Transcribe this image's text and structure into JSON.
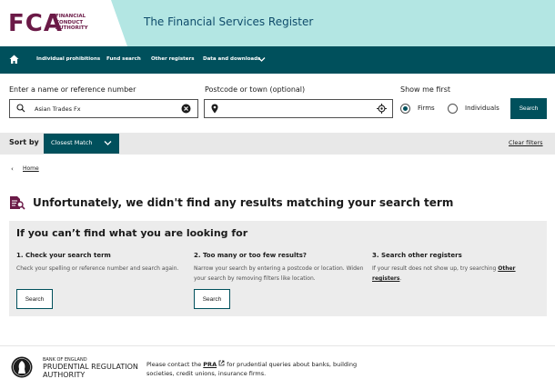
{
  "header": {
    "logo_text": "FCA",
    "logo_tagline": [
      "FINANCIAL",
      "CONDUCT",
      "AUTHORITY"
    ],
    "service_title": "The Financial Services Register",
    "brand_color": "#6b1a47",
    "banner_color": "#b3e6e3"
  },
  "nav": {
    "color": "#00505c",
    "home_icon": "home-icon",
    "items": [
      "Individual prohibitions",
      "Fund search",
      "Other registers",
      "Data and downloads"
    ]
  },
  "search": {
    "name_label": "Enter a name or reference number",
    "name_value": "Asian Trades Fx",
    "postcode_label": "Postcode or town (optional)",
    "postcode_value": "",
    "show_label": "Show me first",
    "options": [
      {
        "label": "Firms",
        "selected": true
      },
      {
        "label": "Individuals",
        "selected": false
      }
    ],
    "button": "Search"
  },
  "sort": {
    "label": "Sort by",
    "value": "Closest Match",
    "clear": "Clear filters"
  },
  "breadcrumb": {
    "home": "Home"
  },
  "no_results": {
    "message": "Unfortunately, we didn't find any results matching your search term",
    "panel_title": "If you can’t find what you are looking for",
    "columns": [
      {
        "title": "1. Check your search term",
        "text": "Check your spelling or reference number and search again.",
        "button": "Search"
      },
      {
        "title": "2. Too many or too few results?",
        "text": "Narrow your search by entering a postcode or location. Widen your search by removing filters like location.",
        "button": "Search"
      },
      {
        "title": "3. Search other registers",
        "text_before": "If your result does not show up, try searching ",
        "link": "Other registers",
        "text_after": "."
      }
    ]
  },
  "footer": {
    "pra_small": "BANK OF ENGLAND",
    "pra_name_1": "PRUDENTIAL REGULATION",
    "pra_name_2": "AUTHORITY",
    "text_before": "Please contact the ",
    "link": "PRA",
    "text_after": " for prudential queries about banks, building societies, credit unions, insurance firms."
  }
}
